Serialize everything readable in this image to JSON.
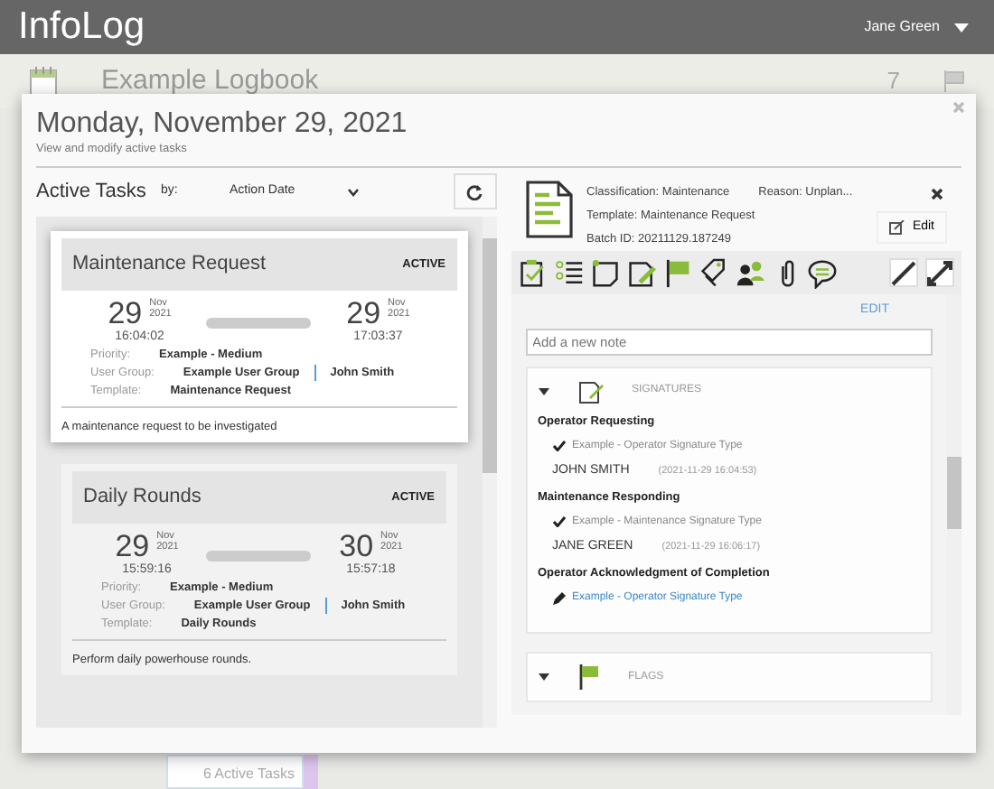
{
  "app": {
    "title": "InfoLog",
    "user": "Jane Green"
  },
  "logbook": {
    "title": "Example Logbook",
    "flag_count": "7",
    "footer": "6 Active Tasks"
  },
  "modal": {
    "title": "Monday, November 29, 2021",
    "subtitle": "View and modify active tasks"
  },
  "task_list": {
    "title": "Active Tasks",
    "sort_label": "by:",
    "sort_value": "Action Date",
    "tasks": [
      {
        "name": "Maintenance Request",
        "status": "ACTIVE",
        "selected": true,
        "start": {
          "day": "29",
          "month": "Nov",
          "year": "2021",
          "time": "16:04:02"
        },
        "end": {
          "day": "29",
          "month": "Nov",
          "year": "2021",
          "time": "17:03:37"
        },
        "priority_label": "Priority:",
        "priority": "Example - Medium",
        "group_label": "User Group:",
        "group": "Example User Group",
        "user": "John Smith",
        "template_label": "Template:",
        "template": "Maintenance Request",
        "description": "A maintenance request to be investigated"
      },
      {
        "name": "Daily Rounds",
        "status": "ACTIVE",
        "selected": false,
        "start": {
          "day": "29",
          "month": "Nov",
          "year": "2021",
          "time": "15:59:16"
        },
        "end": {
          "day": "30",
          "month": "Nov",
          "year": "2021",
          "time": "15:57:18"
        },
        "priority_label": "Priority:",
        "priority": "Example - Medium",
        "group_label": "User Group:",
        "group": "Example User Group",
        "user": "John Smith",
        "template_label": "Template:",
        "template": "Daily Rounds",
        "description": "Perform daily powerhouse rounds."
      }
    ]
  },
  "details": {
    "classification_label": "Classification:",
    "classification": "Maintenance",
    "reason_label": "Reason:",
    "reason": "Unplan...",
    "template_label": "Template:",
    "template": "Maintenance Request",
    "batch_label": "Batch ID:",
    "batch_id": "20211129.187249",
    "edit_button": "Edit",
    "notes": {
      "edit_link": "EDIT",
      "placeholder": "Add a new note"
    },
    "sections": [
      {
        "title": "SIGNATURES",
        "kind": "signatures",
        "expanded": true,
        "signatures": [
          {
            "title": "Operator Requesting",
            "type": "Example - Operator Signature Type",
            "signed": true,
            "signer": "JOHN SMITH",
            "time": "(2021-11-29 16:04:53)"
          },
          {
            "title": "Maintenance Responding",
            "type": "Example - Maintenance Signature Type",
            "signed": true,
            "signer": "JANE GREEN",
            "time": "(2021-11-29 16:06:17)"
          },
          {
            "title": "Operator Acknowledgment of Completion",
            "type": "Example - Operator Signature Type",
            "signed": false
          }
        ]
      },
      {
        "title": "FLAGS",
        "kind": "flags",
        "expanded": true
      }
    ]
  }
}
